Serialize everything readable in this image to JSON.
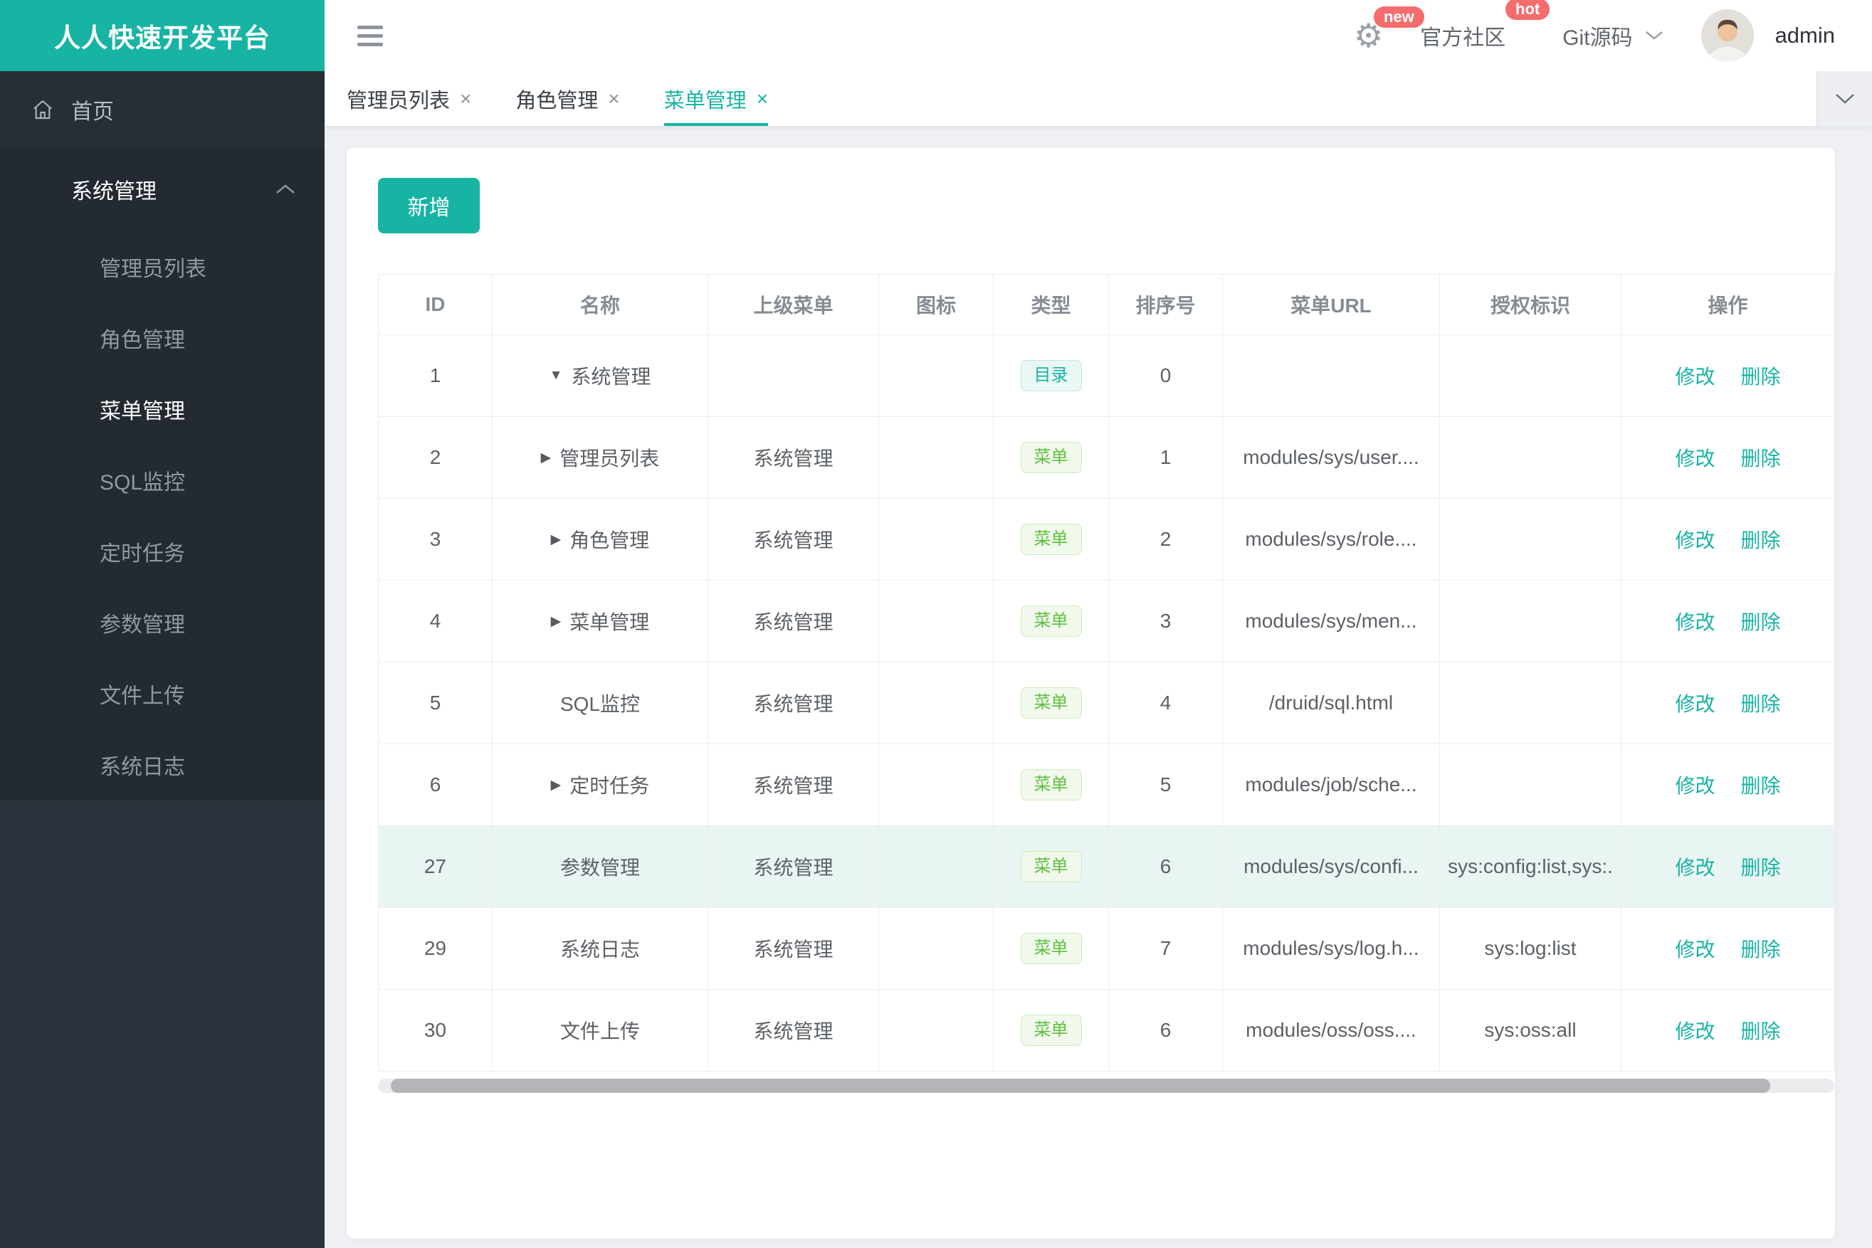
{
  "app": {
    "logo_title": "人人快速开发平台"
  },
  "sidebar": {
    "home_label": "首页",
    "section_label": "系统管理",
    "items": [
      "管理员列表",
      "角色管理",
      "菜单管理",
      "SQL监控",
      "定时任务",
      "参数管理",
      "文件上传",
      "系统日志"
    ],
    "active_item": "菜单管理"
  },
  "header": {
    "new_badge": "new",
    "community_label": "官方社区",
    "hot_badge": "hot",
    "git_label": "Git源码",
    "username": "admin"
  },
  "tabs": [
    {
      "label": "管理员列表",
      "close": "×",
      "active": false
    },
    {
      "label": "角色管理",
      "close": "×",
      "active": false
    },
    {
      "label": "菜单管理",
      "close": "×",
      "active": true
    }
  ],
  "toolbar": {
    "add_label": "新增"
  },
  "table": {
    "columns": [
      "ID",
      "名称",
      "上级菜单",
      "图标",
      "类型",
      "排序号",
      "菜单URL",
      "授权标识",
      "操作"
    ],
    "type_badges": {
      "dir": "目录",
      "menu": "菜单"
    },
    "actions": {
      "edit": "修改",
      "delete": "删除"
    },
    "rows": [
      {
        "id": "1",
        "arrow": "down",
        "name": "系统管理",
        "parent": "",
        "type": "dir",
        "order": "0",
        "url": "",
        "perm": "",
        "highlight": false
      },
      {
        "id": "2",
        "arrow": "right",
        "name": "管理员列表",
        "parent": "系统管理",
        "type": "menu",
        "order": "1",
        "url": "modules/sys/user....",
        "perm": "",
        "highlight": false
      },
      {
        "id": "3",
        "arrow": "right",
        "name": "角色管理",
        "parent": "系统管理",
        "type": "menu",
        "order": "2",
        "url": "modules/sys/role....",
        "perm": "",
        "highlight": false
      },
      {
        "id": "4",
        "arrow": "right",
        "name": "菜单管理",
        "parent": "系统管理",
        "type": "menu",
        "order": "3",
        "url": "modules/sys/men...",
        "perm": "",
        "highlight": false
      },
      {
        "id": "5",
        "arrow": "",
        "name": "SQL监控",
        "parent": "系统管理",
        "type": "menu",
        "order": "4",
        "url": "/druid/sql.html",
        "perm": "",
        "highlight": false
      },
      {
        "id": "6",
        "arrow": "right",
        "name": "定时任务",
        "parent": "系统管理",
        "type": "menu",
        "order": "5",
        "url": "modules/job/sche...",
        "perm": "",
        "highlight": false
      },
      {
        "id": "27",
        "arrow": "",
        "name": "参数管理",
        "parent": "系统管理",
        "type": "menu",
        "order": "6",
        "url": "modules/sys/confi...",
        "perm": "sys:config:list,sys:.",
        "highlight": true
      },
      {
        "id": "29",
        "arrow": "",
        "name": "系统日志",
        "parent": "系统管理",
        "type": "menu",
        "order": "7",
        "url": "modules/sys/log.h...",
        "perm": "sys:log:list",
        "highlight": false
      },
      {
        "id": "30",
        "arrow": "",
        "name": "文件上传",
        "parent": "系统管理",
        "type": "menu",
        "order": "6",
        "url": "modules/oss/oss....",
        "perm": "sys:oss:all",
        "highlight": false
      }
    ]
  },
  "colors": {
    "accent": "#17b3a3",
    "badge_red": "#f56c6c",
    "menu_green": "#5fbf3f",
    "highlight_row": "#e9f5f2"
  }
}
